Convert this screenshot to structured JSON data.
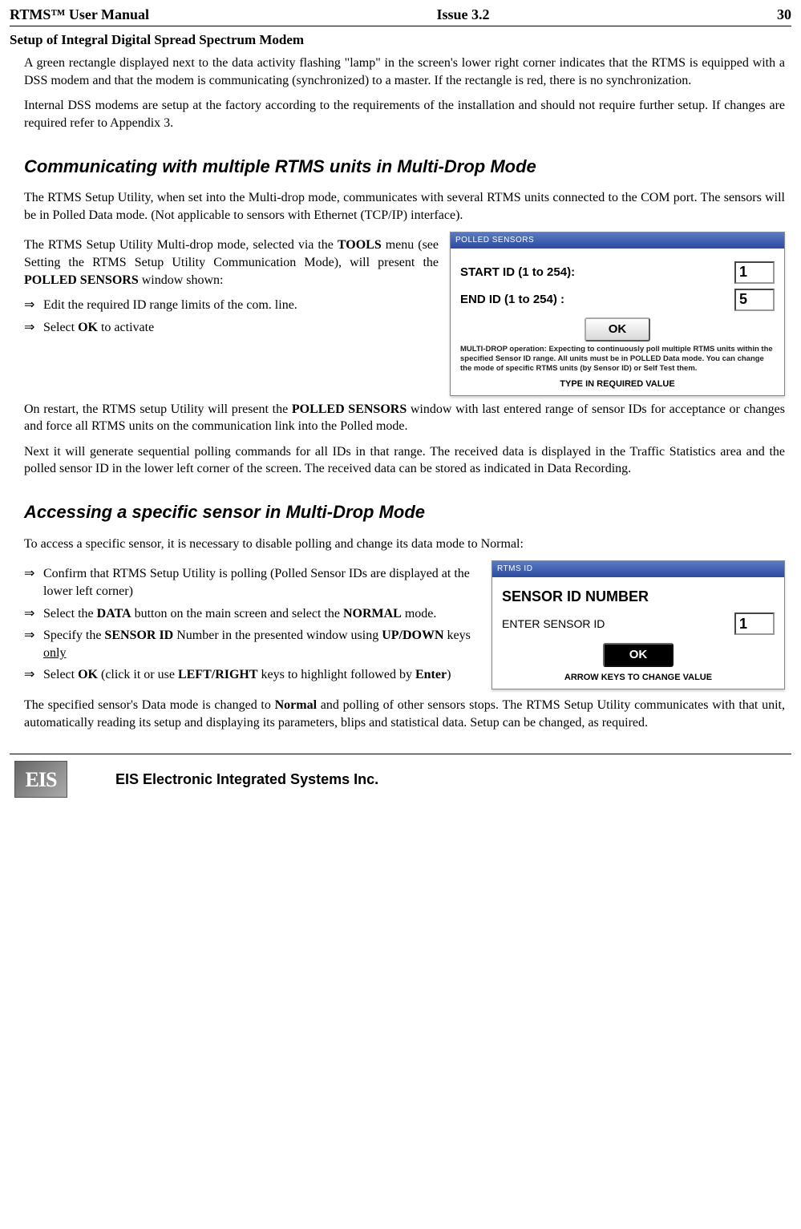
{
  "header": {
    "left": "RTMS™ User Manual",
    "center": "Issue 3.2",
    "right": "30"
  },
  "s_setup": {
    "title": "Setup of Integral Digital Spread Spectrum Modem",
    "p1": "A green rectangle displayed next to the data activity flashing \"lamp\" in the screen's lower right corner indicates that the RTMS is equipped with a DSS modem and that the modem is communicating (synchronized) to a master. If the rectangle is red, there is no synchronization.",
    "p2": "Internal DSS modems are setup at the factory according to the requirements of the installation and should not require further setup.  If changes are required refer to Appendix 3."
  },
  "s_multi": {
    "title": "Communicating with multiple RTMS units in Multi-Drop Mode",
    "p1": "The RTMS Setup Utility, when set into the Multi-drop mode, communicates with several RTMS units connected to the COM port. The sensors will be in Polled Data mode. (Not applicable to sensors with Ethernet  (TCP/IP) interface).",
    "intro_a": "The RTMS Setup Utility Multi-drop mode, selected via the ",
    "intro_b": "TOOLS",
    "intro_c": " menu (see Setting the RTMS Setup Utility Communication Mode), will present the ",
    "intro_d": "POLLED SENSORS",
    "intro_e": " window shown:",
    "b1": "Edit the required ID range limits of the com. line.",
    "b2a": "Select ",
    "b2b": "OK",
    "b2c": " to activate",
    "fig": {
      "titlebar": "POLLED SENSORS",
      "start_label": "START ID (1 to 254):",
      "start_value": "1",
      "end_label": "END ID (1 to 254) :",
      "end_value": "5",
      "ok": "OK",
      "note": "MULTI-DROP operation: Expecting to continuously poll multiple RTMS units within the specified Sensor ID range. All units must be in POLLED Data mode. You can change the mode of specific RTMS units (by Sensor ID) or Self Test them.",
      "footer": "TYPE IN REQUIRED VALUE"
    },
    "p2a": "On restart, the RTMS setup Utility will present the ",
    "p2b": "POLLED SENSORS",
    "p2c": " window with last entered range of sensor IDs for acceptance or changes and force all RTMS units on the communication link into the Polled mode.",
    "p3": "Next it will generate sequential polling commands for all IDs in that range.  The received data is displayed in the Traffic Statistics area and the polled sensor ID in the lower left corner of the screen.  The received data can be stored as indicated in Data Recording."
  },
  "s_access": {
    "title": "Accessing a specific sensor in Multi-Drop Mode",
    "p1": "To access a specific sensor, it is necessary to disable polling and change its data mode to Normal:",
    "b1": "Confirm that RTMS Setup Utility is polling (Polled Sensor IDs are displayed at the lower left corner)",
    "b2a": "Select the ",
    "b2b": "DATA",
    "b2c": " button on the main screen and select the ",
    "b2d": "NORMAL",
    "b2e": " mode.",
    "b3a": "Specify the ",
    "b3b": "SENSOR ID",
    "b3c": " Number  in the presented window using ",
    "b3d": "UP/DOWN",
    "b3e": " keys ",
    "b3f": "only",
    "b4a": "Select ",
    "b4b": "OK",
    "b4c": " (click it or use ",
    "b4d": "LEFT/RIGHT",
    "b4e": " keys to highlight followed by ",
    "b4f": "Enter",
    "b4g": ")",
    "p2a": "The specified sensor's Data mode is changed to ",
    "p2b": "Normal",
    "p2c": " and polling of other sensors stops. The RTMS Setup Utility communicates with that unit, automatically reading its setup and displaying its parameters, blips and statistical data. Setup can be changed, as required.",
    "fig": {
      "titlebar": "RTMS ID",
      "heading": "SENSOR ID NUMBER",
      "label": "ENTER SENSOR ID",
      "value": "1",
      "ok": "OK",
      "footer": "ARROW KEYS TO CHANGE VALUE"
    }
  },
  "footer": {
    "logo": "EIS",
    "text": "EIS Electronic Integrated Systems Inc."
  }
}
